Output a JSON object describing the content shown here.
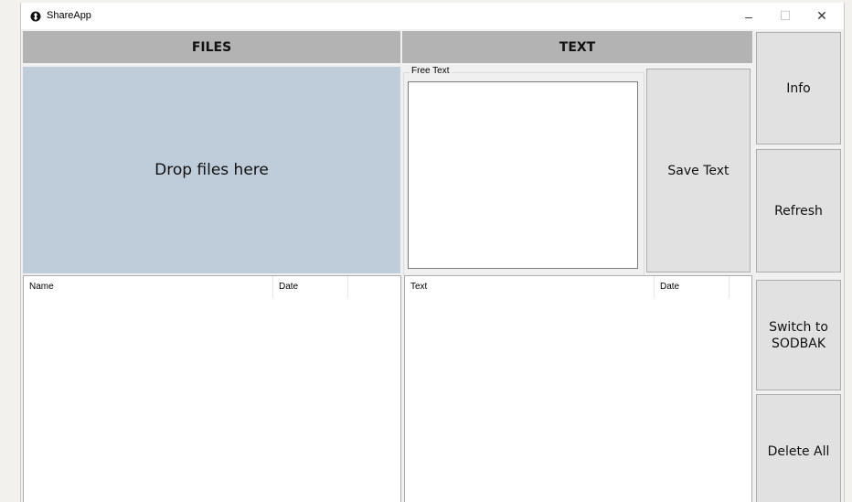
{
  "window": {
    "title": "ShareApp",
    "controls": {
      "minimize": "–",
      "maximize": "☐",
      "close": "✕"
    }
  },
  "files_panel": {
    "header": "FILES",
    "dropzone_label": "Drop files here",
    "columns": [
      "Name",
      "Date"
    ],
    "rows": []
  },
  "text_panel": {
    "header": "TEXT",
    "group_label": "Free Text",
    "free_text_value": "",
    "columns": [
      "Text",
      "Date"
    ],
    "rows": []
  },
  "buttons": {
    "save_text": "Save Text",
    "info": "Info",
    "refresh": "Refresh",
    "switch": "Switch to SODBAK",
    "delete_all": "Delete All"
  },
  "colors": {
    "header_bg": "#b3b3b3",
    "dropzone_bg": "#bfccd9",
    "button_bg": "#e1e1e1"
  }
}
